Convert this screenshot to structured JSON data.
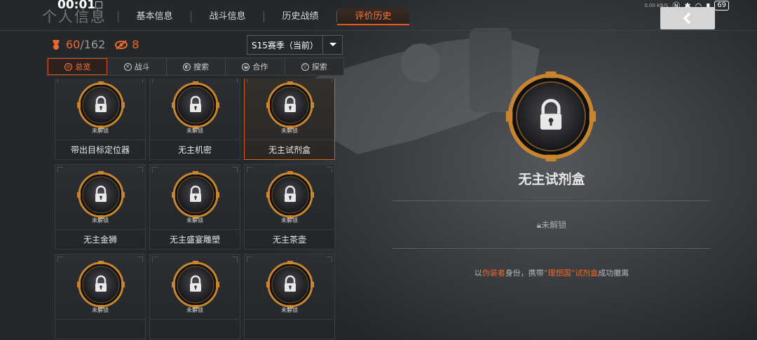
{
  "status": {
    "time": "00:01",
    "battery": "69",
    "net": "0.00 KB/S"
  },
  "header": {
    "title": "个人信息",
    "tabs": [
      {
        "label": "基本信息",
        "active": false
      },
      {
        "label": "战斗信息",
        "active": false
      },
      {
        "label": "历史战绩",
        "active": false
      },
      {
        "label": "评价历史",
        "active": true
      }
    ]
  },
  "stats": {
    "unlocked": "60",
    "total": "/162",
    "eye_count": "8"
  },
  "season": {
    "selected": "S15赛季（当前）"
  },
  "categories": [
    {
      "label": "总览",
      "icon": "overview-icon",
      "active": true
    },
    {
      "label": "战斗",
      "icon": "combat-icon",
      "active": false
    },
    {
      "label": "搜索",
      "icon": "search-icon",
      "active": false
    },
    {
      "label": "合作",
      "icon": "cooperate-icon",
      "active": false
    },
    {
      "label": "探索",
      "icon": "explore-icon",
      "active": false
    }
  ],
  "achievements": [
    {
      "name": "带出目标定位器",
      "status": "未解锁",
      "selected": false
    },
    {
      "name": "无主机密",
      "status": "未解锁",
      "selected": false
    },
    {
      "name": "无主试剂盒",
      "status": "未解锁",
      "selected": true
    },
    {
      "name": "无主金狮",
      "status": "未解锁",
      "selected": false
    },
    {
      "name": "无主盛宴雕塑",
      "status": "未解锁",
      "selected": false
    },
    {
      "name": "无主茶壶",
      "status": "未解锁",
      "selected": false
    },
    {
      "name": "",
      "status": "未解锁",
      "selected": false
    },
    {
      "name": "",
      "status": "未解锁",
      "selected": false
    },
    {
      "name": "",
      "status": "未解锁",
      "selected": false
    }
  ],
  "detail": {
    "name": "无主试剂盒",
    "status": "未解锁",
    "desc_1": "以",
    "desc_role": "伪装者",
    "desc_2": "身份，携带",
    "desc_item": "“理想国”试剂盒",
    "desc_3": "成功撤离"
  },
  "colors": {
    "accent": "#ee6a2c",
    "medal_gold": "#c8852e"
  }
}
